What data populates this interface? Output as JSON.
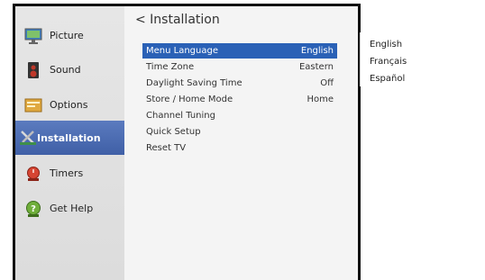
{
  "sidebar": {
    "items": [
      {
        "label": "Picture",
        "icon": "monitor-icon",
        "active": false
      },
      {
        "label": "Sound",
        "icon": "speaker-icon",
        "active": false
      },
      {
        "label": "Options",
        "icon": "options-panel-icon",
        "active": false
      },
      {
        "label": "Installation",
        "icon": "tools-icon",
        "active": true
      },
      {
        "label": "Timers",
        "icon": "timer-icon",
        "active": false
      },
      {
        "label": "Get Help",
        "icon": "help-icon",
        "active": false
      }
    ]
  },
  "main": {
    "title": "< Installation",
    "menu": [
      {
        "label": "Menu Language",
        "value": "English",
        "selected": true
      },
      {
        "label": "Time Zone",
        "value": "Eastern"
      },
      {
        "label": "Daylight Saving Time",
        "value": "Off"
      },
      {
        "label": "Store / Home Mode",
        "value": "Home"
      },
      {
        "label": "Channel Tuning",
        "value": ""
      },
      {
        "label": "Quick Setup",
        "value": ""
      },
      {
        "label": "Reset TV",
        "value": ""
      }
    ]
  },
  "dropdown": {
    "options": [
      "English",
      "Français",
      "Español"
    ]
  },
  "colors": {
    "highlight": "#2a61b6",
    "sidebar_active": "#4a6ab0"
  }
}
